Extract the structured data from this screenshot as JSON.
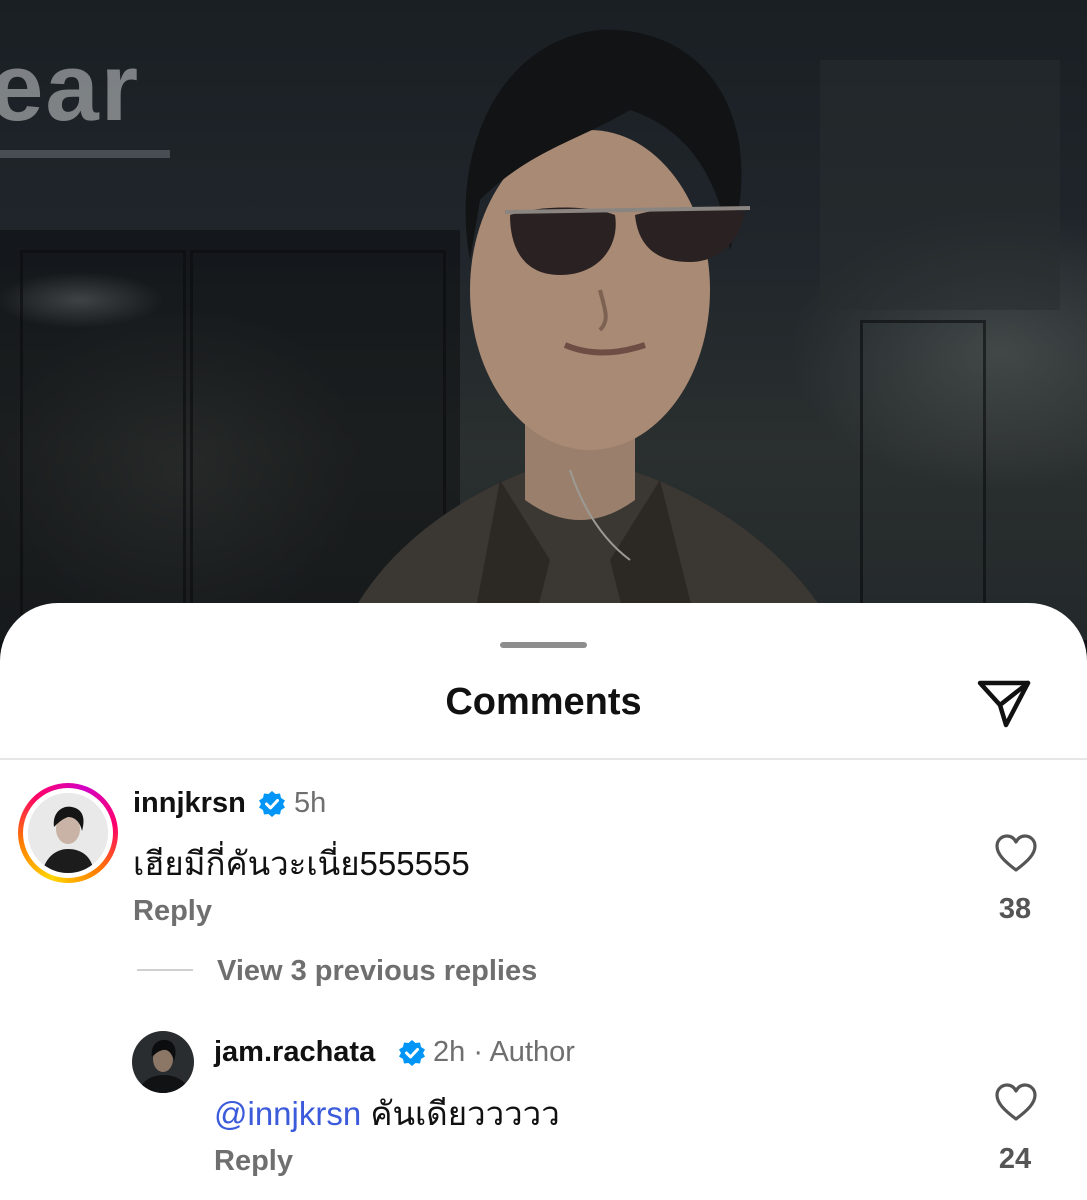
{
  "background": {
    "store_sign_text": "ear"
  },
  "sheet": {
    "title": "Comments",
    "share_icon": "send-icon"
  },
  "comments": [
    {
      "username": "innjkrsn",
      "verified": true,
      "time": "5h",
      "text": "เฮียมีกี่คันวะเนี่ย555555",
      "reply_label": "Reply",
      "likes": "38",
      "has_story_ring": true
    }
  ],
  "view_replies_label": "View 3 previous replies",
  "replies": [
    {
      "username": "jam.rachata",
      "verified": true,
      "time": "2h",
      "separator": "·",
      "badge": "Author",
      "mention": "@innjkrsn",
      "text": "คันเดียววววว",
      "reply_label": "Reply",
      "likes": "24"
    }
  ],
  "colors": {
    "verified_blue": "#0095f6",
    "mention_blue": "#3b5bdb",
    "story_ring": [
      "#ffd600",
      "#ff7a00",
      "#ff0069",
      "#d300c5"
    ]
  }
}
